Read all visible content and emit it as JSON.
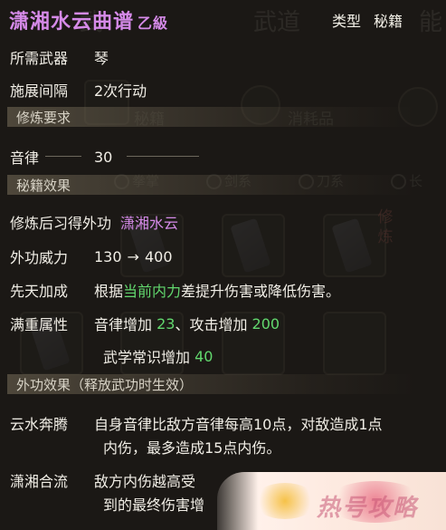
{
  "item": {
    "name": "潇湘水云曲谱",
    "grade": "乙級",
    "type_label": "类型",
    "type_value": "秘籍"
  },
  "rows": {
    "weapon": {
      "label": "所需武器",
      "value": "琴"
    },
    "interval": {
      "label": "施展间隔",
      "value": "2次行动"
    }
  },
  "sections": {
    "requirement": "修炼要求",
    "effect": "秘籍效果",
    "skill_effect": "外功效果（释放武功时生效）"
  },
  "requirement": {
    "label": "音律",
    "value": "30"
  },
  "effect": {
    "learn": {
      "label": "修炼后习得外功",
      "value": "潇湘水云"
    },
    "power": {
      "label": "外功威力",
      "min": "130",
      "arrow": "→",
      "max": "400"
    },
    "innate": {
      "label": "先天加成",
      "pre": "根据",
      "highlight": "当前内力",
      "post": "差提升伤害或降低伤害。"
    },
    "full": {
      "label": "满重属性",
      "line1_a": "音律增加 ",
      "line1_a_val": "23",
      "line1_sep": "、攻击增加 ",
      "line1_b_val": "200",
      "line2_a": "武学常识增加 ",
      "line2_a_val": "40"
    }
  },
  "skill_effects": [
    {
      "name": "云水奔腾",
      "line1": "自身音律比敌方音律每高10点，对敌造成1点",
      "line2": "内伤，最多造成15点内伤。"
    },
    {
      "name": "潇湘合流",
      "line1": "敌方内伤越高受",
      "line2": "到的最终伤害增"
    }
  ],
  "background": {
    "tab_partial_left": "武",
    "tab_wudao": "武道",
    "tab_partial_right": "能",
    "cat_miji": "秘籍",
    "cat_xiaohao": "消耗品",
    "filters": [
      "拳掌",
      "剑系",
      "刀系",
      "长"
    ],
    "badge": "修炼"
  },
  "watermark": {
    "text": "热号攻略"
  },
  "colors": {
    "title": "#d58ae8",
    "green": "#62d86e",
    "text": "#f1eee6"
  }
}
